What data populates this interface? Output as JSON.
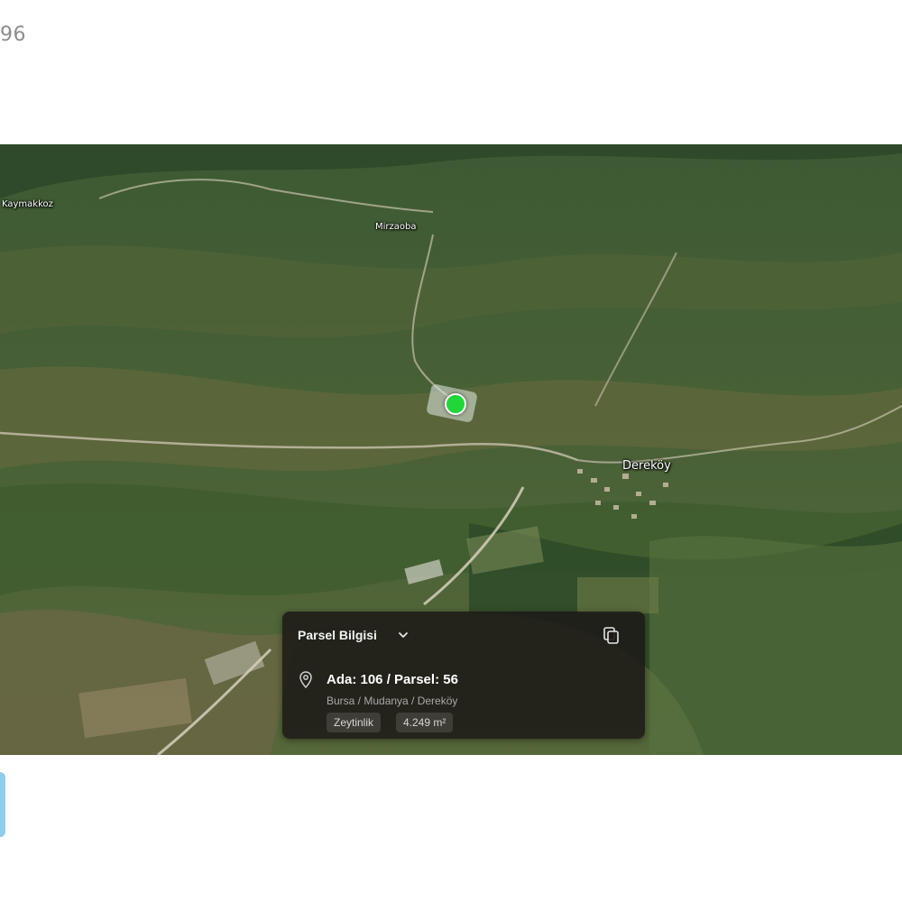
{
  "page": {
    "top_fragment": "96"
  },
  "map": {
    "place_labels": [
      {
        "name": "Kaymakkoz"
      },
      {
        "name": "Mirzaoba"
      },
      {
        "name": "Dereköy"
      }
    ],
    "marker_color": "#22d638"
  },
  "parcel_card": {
    "title": "Parsel Bilgisi",
    "main": "Ada: 106 / Parsel: 56",
    "location": "Bursa / Mudanya / Dereköy",
    "land_type": "Zeytinlik",
    "area": "4.249 m²",
    "icons": {
      "dropdown": "chevron-down-icon",
      "copy": "copy-icon",
      "location": "map-pin-icon"
    },
    "background_color": "#1c1816"
  }
}
